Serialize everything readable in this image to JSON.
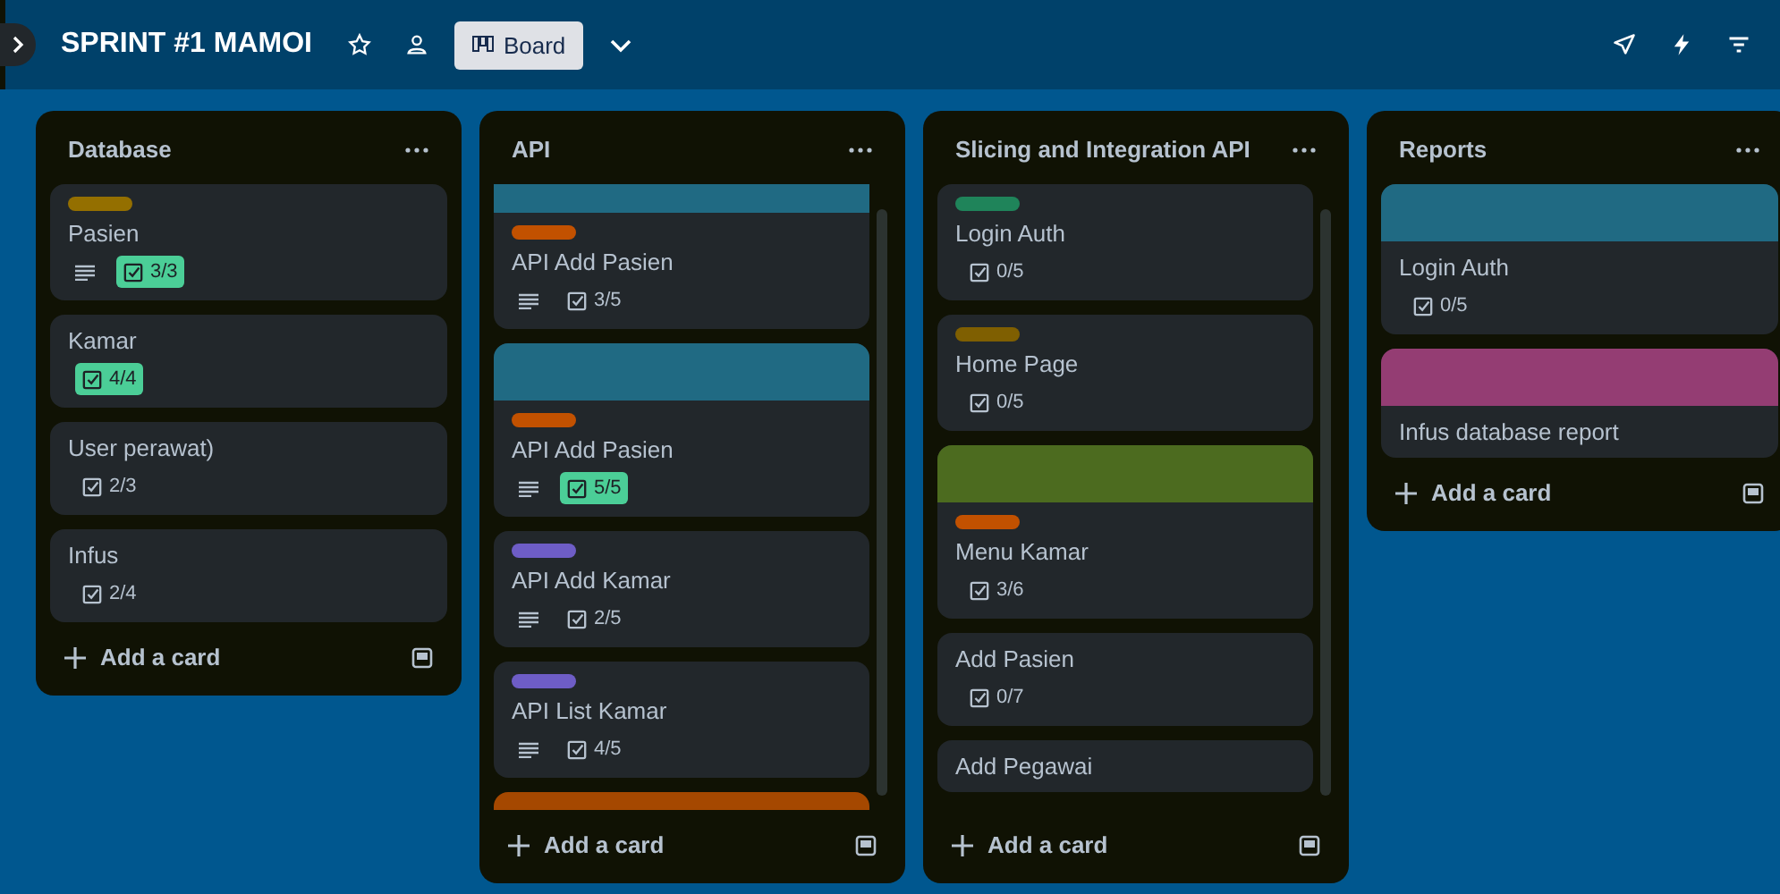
{
  "board": {
    "title": "SPRINT #1 MAMOI",
    "view": "Board"
  },
  "lists": [
    {
      "title": "Database",
      "overflow": false,
      "scrolled": false,
      "add_label": "Add a card",
      "cards": [
        {
          "title": "Pasien",
          "label": {
            "color": "#946f00"
          },
          "description": true,
          "checklist": "3/3",
          "complete": true
        },
        {
          "title": "Kamar",
          "description": false,
          "checklist": "4/4",
          "complete": true
        },
        {
          "title": "User perawat)",
          "description": false,
          "checklist": "2/3",
          "complete": false
        },
        {
          "title": "Infus",
          "description": false,
          "checklist": "2/4",
          "complete": false
        }
      ]
    },
    {
      "title": "API",
      "overflow": true,
      "scrolled": true,
      "add_label": "Add a card",
      "cards": [
        {
          "title": "API Add Pasien",
          "cover": {
            "color": "#206a83"
          },
          "label": {
            "color": "#c25100"
          },
          "description": true,
          "checklist": "3/5",
          "complete": false
        },
        {
          "title": "API Add Pasien",
          "cover": {
            "color": "#206a83"
          },
          "label": {
            "color": "#c25100"
          },
          "description": true,
          "checklist": "5/5",
          "complete": true
        },
        {
          "title": "API Add Kamar",
          "label": {
            "color": "#6e5dc6"
          },
          "description": true,
          "checklist": "2/5",
          "complete": false
        },
        {
          "title": "API List Kamar",
          "label": {
            "color": "#6e5dc6"
          },
          "description": true,
          "checklist": "4/5",
          "complete": false
        },
        {
          "cover": {
            "color": "#a54800"
          }
        }
      ]
    },
    {
      "title": "Slicing and Integration API",
      "overflow": true,
      "scrolled": false,
      "add_label": "Add a card",
      "cards": [
        {
          "title": "Login Auth",
          "label": {
            "color": "#1f845a"
          },
          "description": false,
          "checklist": "0/5",
          "complete": false
        },
        {
          "title": "Home Page",
          "label": {
            "color": "#7f5f01"
          },
          "description": false,
          "checklist": "0/5",
          "complete": false
        },
        {
          "title": "Menu Kamar",
          "cover": {
            "color": "#4c6b1f"
          },
          "label": {
            "color": "#c25100"
          },
          "description": false,
          "checklist": "3/6",
          "complete": false
        },
        {
          "title": "Add Pasien",
          "description": false,
          "checklist": "0/7",
          "complete": false
        },
        {
          "title": "Add Pegawai",
          "description": false
        }
      ]
    },
    {
      "title": "Reports",
      "overflow": false,
      "scrolled": false,
      "add_label": "Add a card",
      "cards": [
        {
          "title": "Login Auth",
          "cover": {
            "color": "#206a83"
          },
          "description": false,
          "checklist": "0/5",
          "complete": false
        },
        {
          "title": "Infus database report",
          "cover": {
            "color": "#943d73"
          },
          "description": false
        }
      ]
    }
  ]
}
